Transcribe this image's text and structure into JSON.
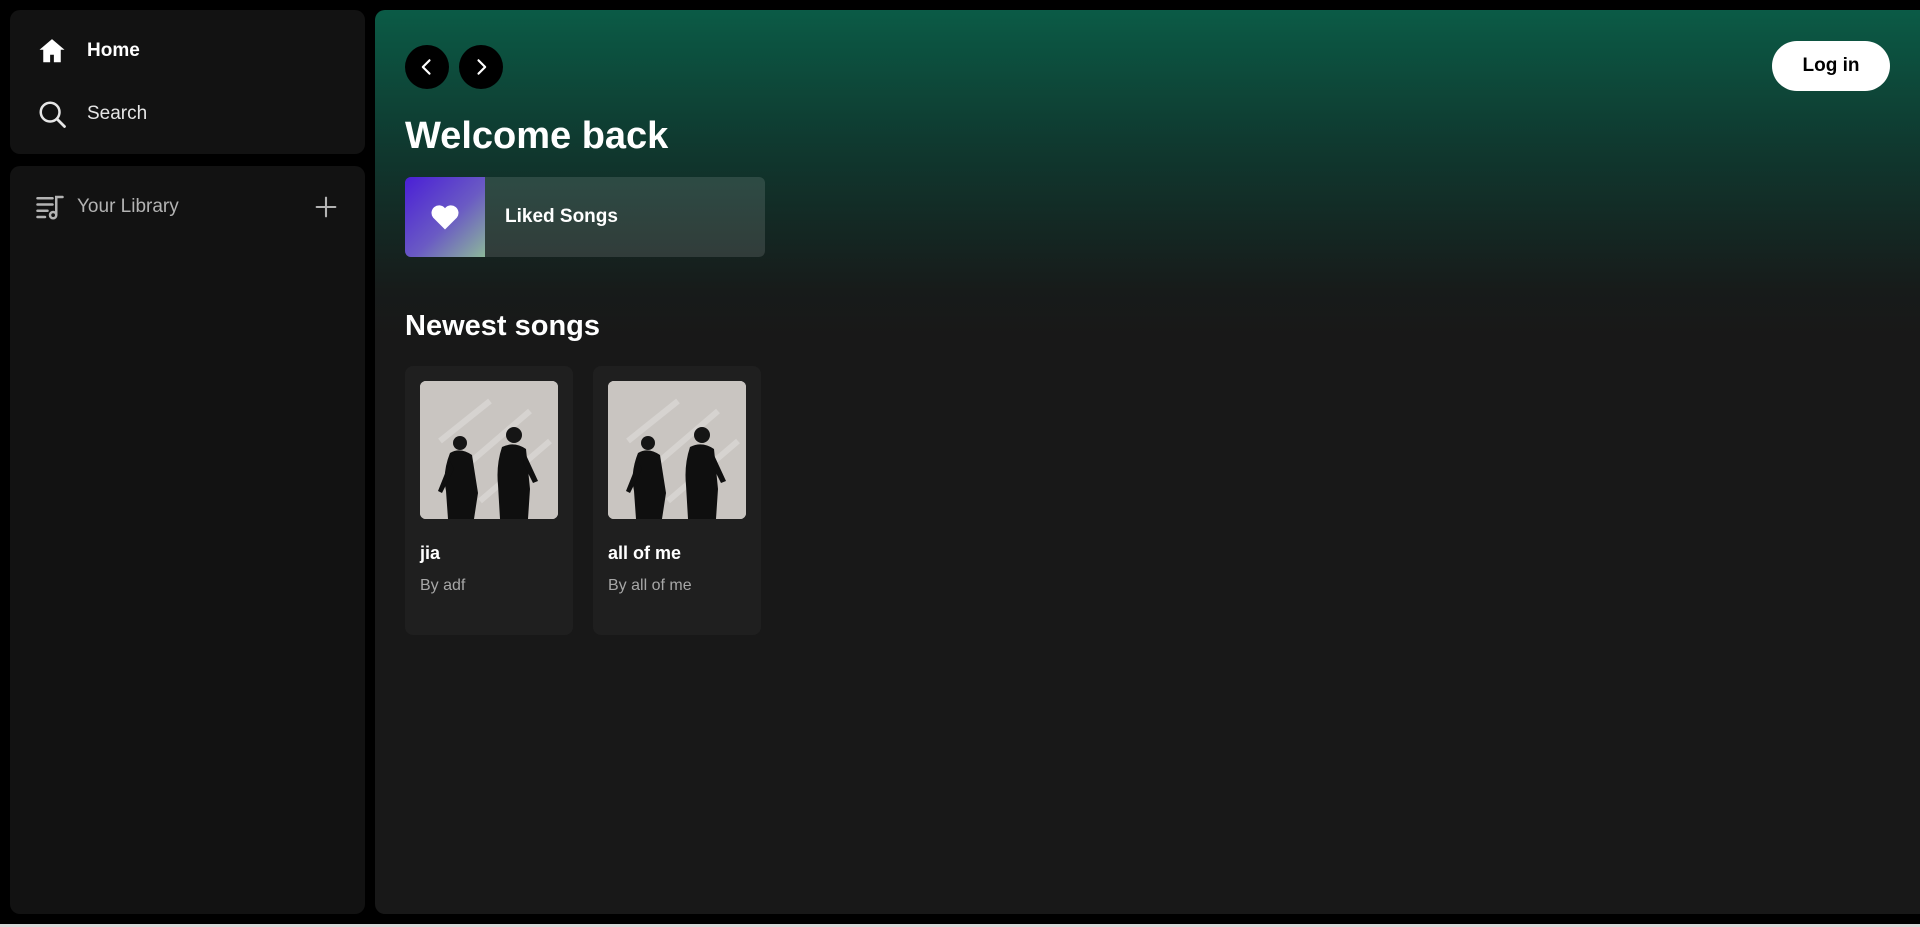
{
  "sidebar": {
    "nav": [
      {
        "label": "Home",
        "icon": "home-icon"
      },
      {
        "label": "Search",
        "icon": "search-icon"
      }
    ],
    "library": {
      "label": "Your Library",
      "icon": "library-icon",
      "add_icon": "plus-icon"
    }
  },
  "header": {
    "back_icon": "chevron-left-icon",
    "forward_icon": "chevron-right-icon",
    "login_label": "Log in"
  },
  "main": {
    "greeting": "Welcome back",
    "liked": {
      "label": "Liked Songs",
      "icon": "heart-icon"
    },
    "newest_title": "Newest songs",
    "songs": [
      {
        "title": "jia",
        "artist": "By adf"
      },
      {
        "title": "all of me",
        "artist": "By all of me"
      }
    ]
  },
  "colors": {
    "accent_green": "#0b5b46",
    "surface": "#121212",
    "card": "#1f1f1f",
    "liked_gradient_start": "#4a1fd6",
    "liked_gradient_end": "#8cb79a"
  }
}
